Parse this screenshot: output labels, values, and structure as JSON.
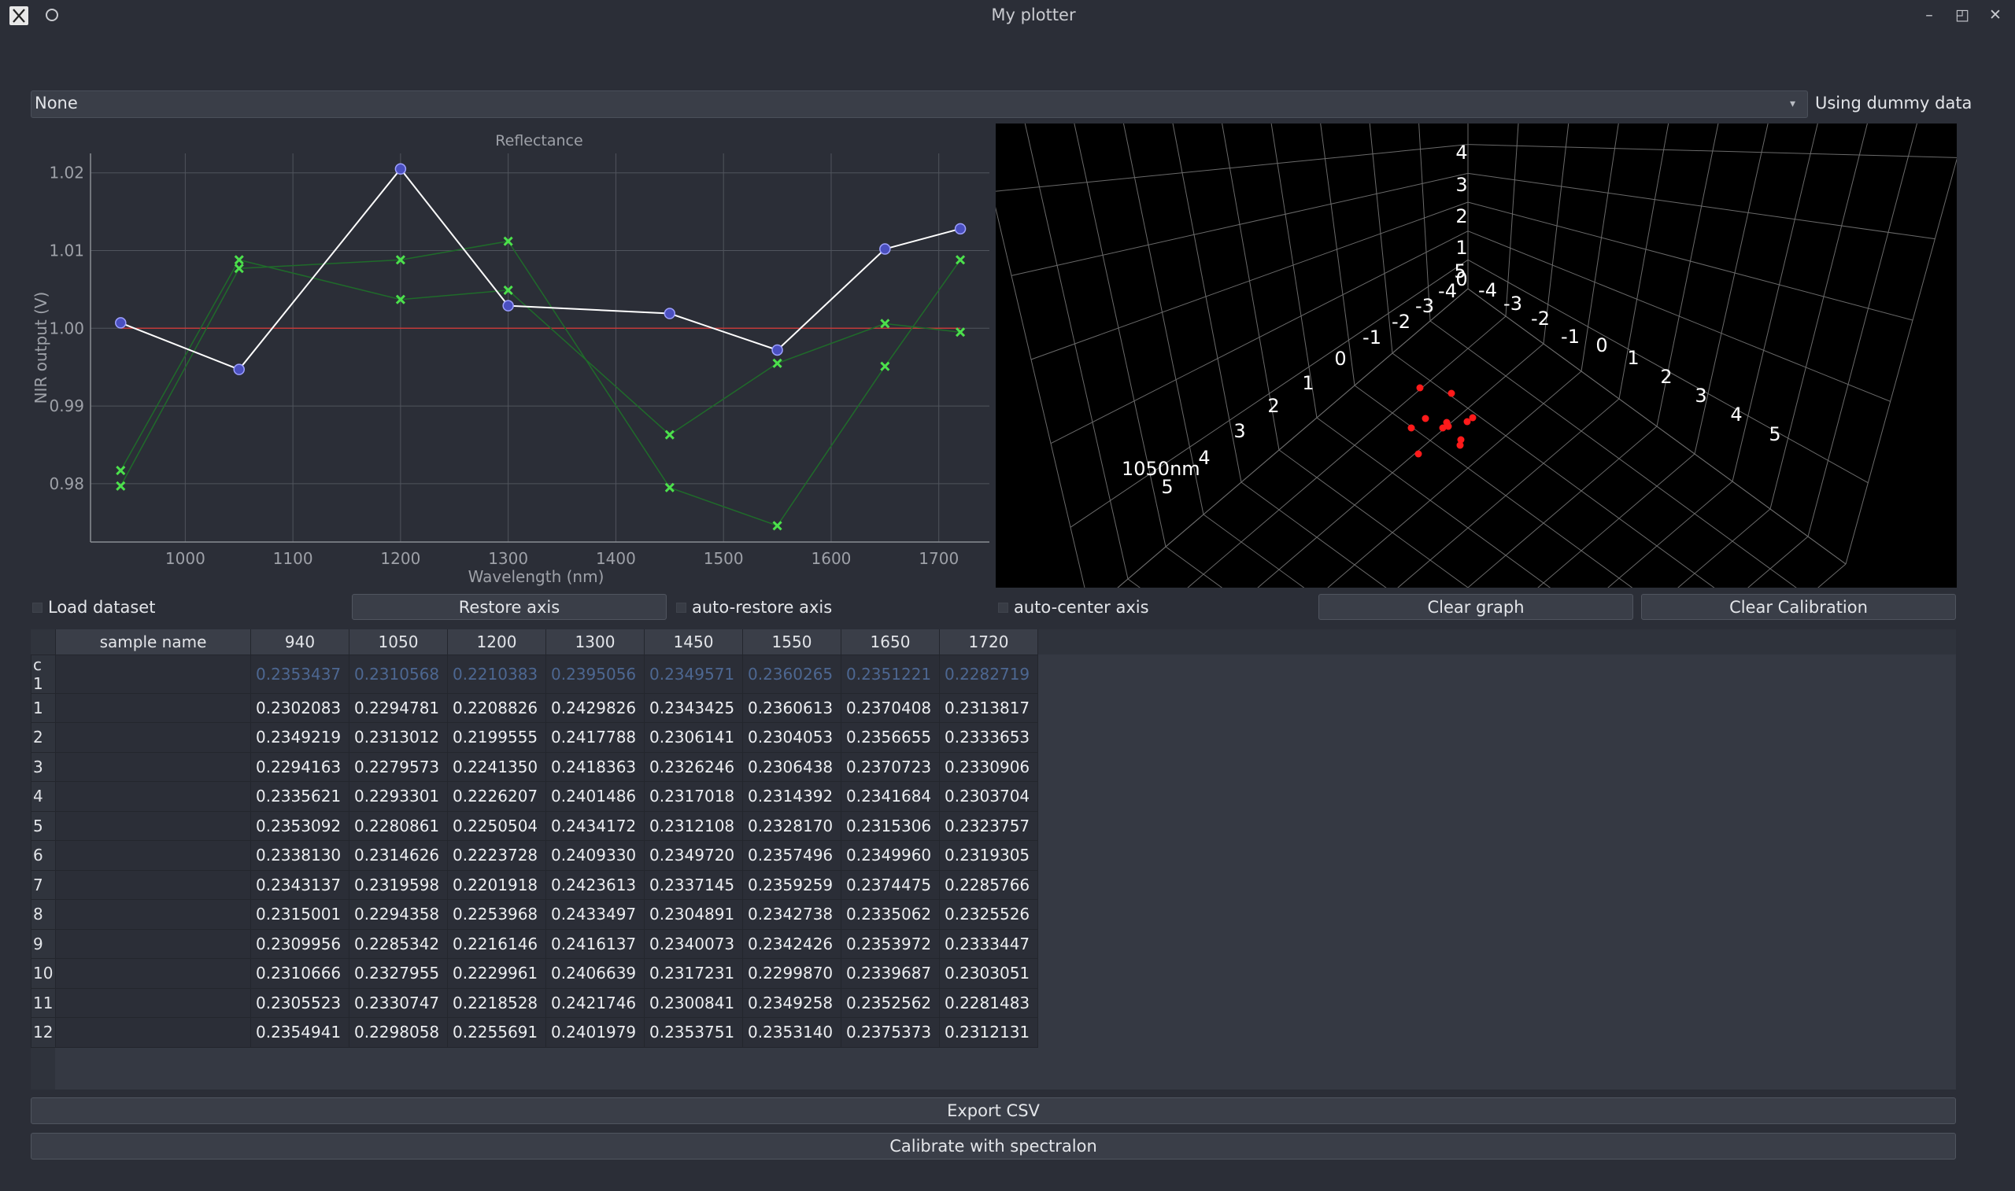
{
  "window": {
    "title": "My plotter",
    "icons": [
      "app-x-icon",
      "circle-icon",
      "minimize-icon",
      "maximize-icon",
      "close-icon"
    ],
    "minimize_glyph": "–",
    "maximize_glyph": "◰",
    "close_glyph": "✕"
  },
  "source": {
    "selected": "None",
    "status": "Using dummy data"
  },
  "chart_data": {
    "type": "line",
    "title": "Reflectance",
    "xlabel": "Wavelength (nm)",
    "ylabel": "NIR output (V)",
    "xlim": [
      912,
      1747
    ],
    "ylim": [
      0.9725,
      1.0225
    ],
    "xticks": [
      1000,
      1100,
      1200,
      1300,
      1400,
      1500,
      1600,
      1700
    ],
    "yticks": [
      0.98,
      0.99,
      1.0,
      1.01,
      1.02
    ],
    "ytick_labels": [
      "0.98",
      "0.99",
      "1.00",
      "1.01",
      "1.02"
    ],
    "reference_line": 1.0,
    "series": [
      {
        "style": "white-line-blue-dots",
        "x": [
          940,
          1050,
          1200,
          1300,
          1450,
          1550,
          1650,
          1720
        ],
        "values": [
          1.0007,
          0.9947,
          1.0205,
          1.0029,
          1.0019,
          0.9972,
          1.0102,
          1.0128
        ]
      },
      {
        "style": "green-x",
        "x": [
          940,
          1050,
          1200,
          1300,
          1450,
          1550,
          1650,
          1720
        ],
        "values": [
          0.9817,
          1.0088,
          1.0037,
          1.0049,
          0.9863,
          0.9955,
          1.0006,
          0.9995
        ]
      },
      {
        "style": "green-x",
        "x": [
          940,
          1050,
          1200,
          1300,
          1450,
          1550,
          1650,
          1720
        ],
        "values": [
          0.9797,
          1.0077,
          1.0088,
          1.0112,
          0.9795,
          0.9746,
          0.9951,
          1.0088
        ]
      }
    ]
  },
  "scatter3d": {
    "z_ticks": [
      "4",
      "3",
      "2",
      "1",
      "0",
      "5"
    ],
    "x_ticks": [
      "-4",
      "-3",
      "-2",
      "-1",
      "0",
      "1",
      "2",
      "3",
      "4",
      "5"
    ],
    "y_ticks": [
      "-4",
      "-3",
      "-2",
      "-1",
      "0",
      "1",
      "2",
      "3",
      "4",
      "5"
    ],
    "axis_label": "1050nm",
    "point_count": 12
  },
  "controls": {
    "load_dataset": "Load dataset",
    "restore_axis": "Restore axis",
    "auto_restore": "auto-restore axis",
    "auto_center": "auto-center axis",
    "clear_graph": "Clear graph",
    "clear_calibration": "Clear Calibration"
  },
  "table": {
    "headers": [
      "sample name",
      "940",
      "1050",
      "1200",
      "1300",
      "1450",
      "1550",
      "1650",
      "1720"
    ],
    "rows": [
      {
        "label": "c 1",
        "name": "",
        "values": [
          "0.2353437",
          "0.2310568",
          "0.2210383",
          "0.2395056",
          "0.2349571",
          "0.2360265",
          "0.2351221",
          "0.2282719"
        ]
      },
      {
        "label": "1",
        "name": "",
        "values": [
          "0.2302083",
          "0.2294781",
          "0.2208826",
          "0.2429826",
          "0.2343425",
          "0.2360613",
          "0.2370408",
          "0.2313817"
        ]
      },
      {
        "label": "2",
        "name": "",
        "values": [
          "0.2349219",
          "0.2313012",
          "0.2199555",
          "0.2417788",
          "0.2306141",
          "0.2304053",
          "0.2356655",
          "0.2333653"
        ]
      },
      {
        "label": "3",
        "name": "",
        "values": [
          "0.2294163",
          "0.2279573",
          "0.2241350",
          "0.2418363",
          "0.2326246",
          "0.2306438",
          "0.2370723",
          "0.2330906"
        ]
      },
      {
        "label": "4",
        "name": "",
        "values": [
          "0.2335621",
          "0.2293301",
          "0.2226207",
          "0.2401486",
          "0.2317018",
          "0.2314392",
          "0.2341684",
          "0.2303704"
        ]
      },
      {
        "label": "5",
        "name": "",
        "values": [
          "0.2353092",
          "0.2280861",
          "0.2250504",
          "0.2434172",
          "0.2312108",
          "0.2328170",
          "0.2315306",
          "0.2323757"
        ]
      },
      {
        "label": "6",
        "name": "",
        "values": [
          "0.2338130",
          "0.2314626",
          "0.2223728",
          "0.2409330",
          "0.2349720",
          "0.2357496",
          "0.2349960",
          "0.2319305"
        ]
      },
      {
        "label": "7",
        "name": "",
        "values": [
          "0.2343137",
          "0.2319598",
          "0.2201918",
          "0.2423613",
          "0.2337145",
          "0.2359259",
          "0.2374475",
          "0.2285766"
        ]
      },
      {
        "label": "8",
        "name": "",
        "values": [
          "0.2315001",
          "0.2294358",
          "0.2253968",
          "0.2433497",
          "0.2304891",
          "0.2342738",
          "0.2335062",
          "0.2325526"
        ]
      },
      {
        "label": "9",
        "name": "",
        "values": [
          "0.2309956",
          "0.2285342",
          "0.2216146",
          "0.2416137",
          "0.2340073",
          "0.2342426",
          "0.2353972",
          "0.2333447"
        ]
      },
      {
        "label": "10",
        "name": "",
        "values": [
          "0.2310666",
          "0.2327955",
          "0.2229961",
          "0.2406639",
          "0.2317231",
          "0.2299870",
          "0.2339687",
          "0.2303051"
        ]
      },
      {
        "label": "11",
        "name": "",
        "values": [
          "0.2305523",
          "0.2330747",
          "0.2218528",
          "0.2421746",
          "0.2300841",
          "0.2349258",
          "0.2352562",
          "0.2281483"
        ]
      },
      {
        "label": "12",
        "name": "",
        "values": [
          "0.2354941",
          "0.2298058",
          "0.2255691",
          "0.2401979",
          "0.2353751",
          "0.2353140",
          "0.2375373",
          "0.2312131"
        ]
      }
    ]
  },
  "actions": {
    "export": "Export CSV",
    "calibrate": "Calibrate with spectralon"
  }
}
